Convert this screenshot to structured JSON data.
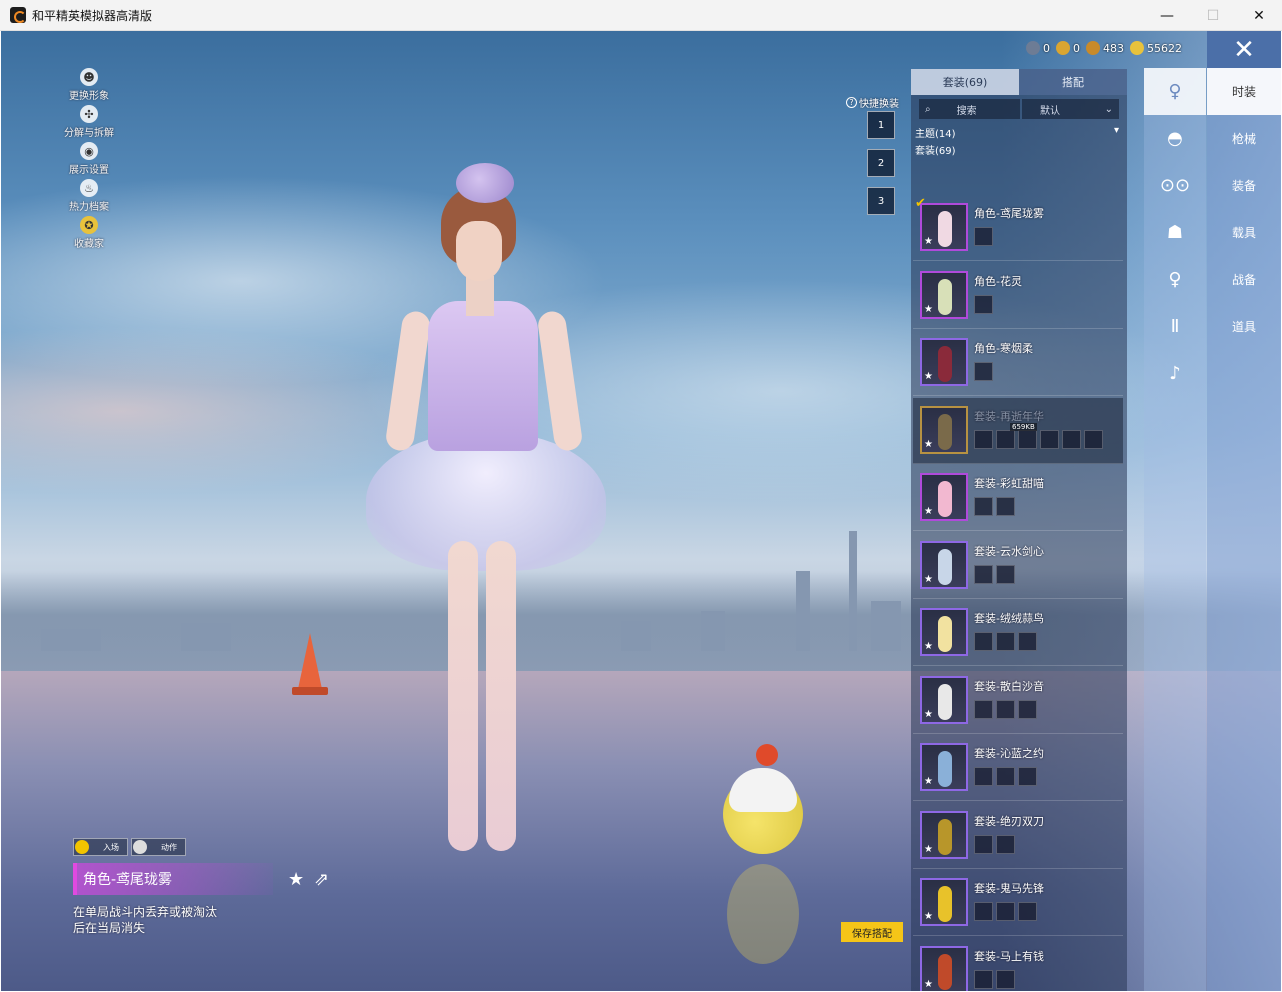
{
  "window": {
    "title": "和平精英模拟器高清版",
    "minimize": "—",
    "maximize": "☐",
    "close": "✕"
  },
  "left_menu": [
    {
      "label": "更换形象",
      "icon": "person-icon"
    },
    {
      "label": "分解与拆解",
      "icon": "puzzle-icon"
    },
    {
      "label": "展示设置",
      "icon": "eye-icon"
    },
    {
      "label": "热力档案",
      "icon": "flame-icon"
    },
    {
      "label": "收藏家",
      "icon": "badge-icon"
    }
  ],
  "currency": [
    {
      "value": "0",
      "color": "#6d7c95"
    },
    {
      "value": "0",
      "color": "#d9a531"
    },
    {
      "value": "483",
      "color": "#c88a2a"
    },
    {
      "value": "55622",
      "color": "#e8c23c"
    }
  ],
  "close_label": "✕",
  "categories": [
    {
      "icon": "figure-icon",
      "active": true
    },
    {
      "icon": "cap-icon"
    },
    {
      "icon": "goggles-icon"
    },
    {
      "icon": "mask-icon"
    },
    {
      "icon": "body-suit-icon"
    },
    {
      "icon": "pants-icon"
    },
    {
      "icon": "shoes-icon"
    }
  ],
  "right_tabs": [
    {
      "label": "时装",
      "active": true
    },
    {
      "label": "枪械"
    },
    {
      "label": "装备"
    },
    {
      "label": "载具"
    },
    {
      "label": "战备"
    },
    {
      "label": "道具"
    }
  ],
  "quick_change": {
    "label": "快捷换装",
    "slots": [
      "1",
      "2",
      "3"
    ]
  },
  "panel": {
    "tabs": [
      {
        "label": "套装(69)",
        "active": true
      },
      {
        "label": "搭配"
      }
    ],
    "search_label": "搜索",
    "sort_label": "默认",
    "group_theme": "主题(14)",
    "group_suit": "套装(69)",
    "items": [
      {
        "name": "角色-鸢尾珑雾",
        "border": "pink",
        "fig": "#f0d9e3",
        "subs": 1,
        "equipped": true
      },
      {
        "name": "角色-花灵",
        "border": "pink",
        "fig": "#d8e0b8",
        "subs": 1
      },
      {
        "name": "角色-寒烟柔",
        "border": "purple",
        "fig": "#8a2a3a",
        "subs": 1
      },
      {
        "name": "套装-再逝年华",
        "border": "gold",
        "fig": "#7a6a4a",
        "subs": 6,
        "dim": true,
        "download": "659KB"
      },
      {
        "name": "套装-彩虹甜喵",
        "border": "pink",
        "fig": "#f2b8d0",
        "subs": 2
      },
      {
        "name": "套装-云水剑心",
        "border": "purple",
        "fig": "#c8d6e8",
        "subs": 2
      },
      {
        "name": "套装-绒绒蒜鸟",
        "border": "purple",
        "fig": "#f2e2a0",
        "subs": 3
      },
      {
        "name": "套装-散白沙音",
        "border": "purple",
        "fig": "#e8e8e8",
        "subs": 3
      },
      {
        "name": "套装-沁蓝之约",
        "border": "purple",
        "fig": "#8ab0d8",
        "subs": 3
      },
      {
        "name": "套装-绝刃双刀",
        "border": "purple",
        "fig": "#b8962a",
        "subs": 2
      },
      {
        "name": "套装-鬼马先锋",
        "border": "purple",
        "fig": "#e8c22a",
        "subs": 3
      },
      {
        "name": "套装-马上有钱",
        "border": "purple",
        "fig": "#c04a2a",
        "subs": 2
      }
    ]
  },
  "save_button": "保存搭配",
  "bottom": {
    "tab_entry": "入场",
    "tab_action": "动作",
    "outfit_name": "角色-鸢尾珑雾",
    "star": "★",
    "share": "⇗",
    "description": "在单局战斗内丢弃或被淘汰后在当局消失"
  }
}
